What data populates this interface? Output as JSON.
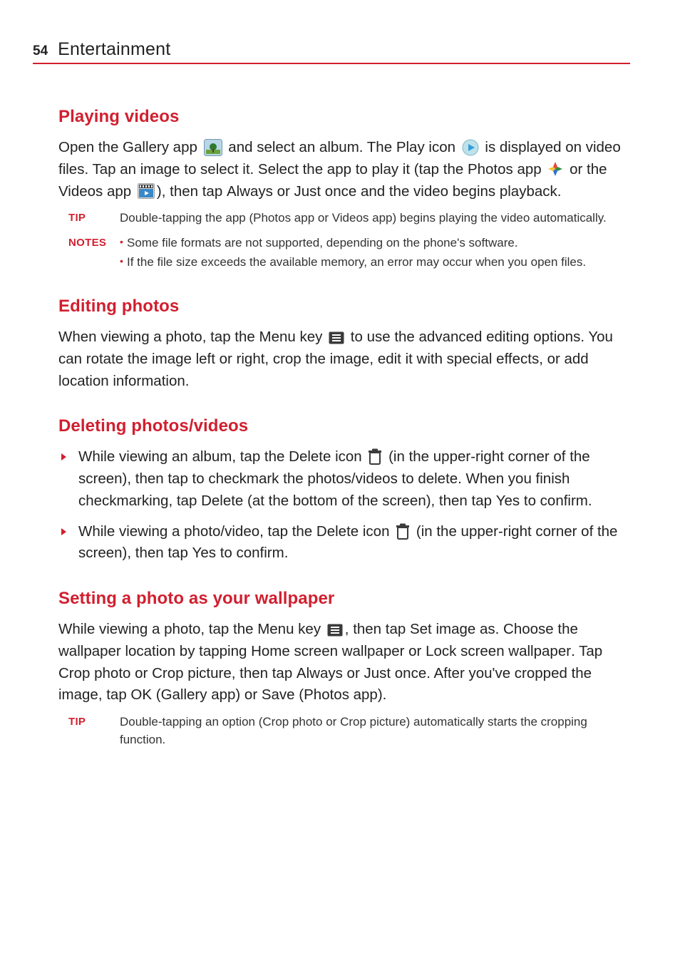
{
  "header": {
    "page_number": "54",
    "title": "Entertainment"
  },
  "sections": {
    "playing_videos": {
      "heading": "Playing videos",
      "p1a": "Open the ",
      "p1b": "Gallery",
      "p1c": " app ",
      "p1d": " and select an album. The ",
      "p1e": "Play",
      "p1f": " icon ",
      "p1g": " is displayed on video files. Tap an image to select it. Select the app to play it (tap the ",
      "p1h": "Photos",
      "p1i": " app ",
      "p1j": " or the ",
      "p1k": "Videos",
      "p1l": " app ",
      "p1m": "), then tap ",
      "p1n": "Always",
      "p1o": " or ",
      "p1p": "Just once",
      "p1q": " and the video begins playback.",
      "tip_label": "TIP",
      "tip1a": "Double-tapping the app (",
      "tip1b": "Photos",
      "tip1c": " app or ",
      "tip1d": "Videos",
      "tip1e": " app) begins playing the video automatically.",
      "notes_label": "NOTES",
      "note1": "Some file formats are not supported, depending on the phone's software.",
      "note2": "If the file size exceeds the available memory, an error may occur when you open files."
    },
    "editing_photos": {
      "heading": "Editing photos",
      "p1a": "When viewing a photo, tap the ",
      "p1b": "Menu key",
      "p1c": " ",
      "p1d": " to use the advanced editing options. You can rotate the image left or right, crop the image, edit it with special effects, or add location information."
    },
    "deleting": {
      "heading": "Deleting photos/videos",
      "li1a": "While viewing an album, tap the ",
      "li1b": "Delete",
      "li1c": " icon ",
      "li1d": " (in the upper-right corner of the screen), then tap to checkmark the photos/videos to delete. When you finish checkmarking, tap ",
      "li1e": "Delete",
      "li1f": " (at the bottom of the screen), then tap ",
      "li1g": "Yes",
      "li1h": " to confirm.",
      "li2a": "While viewing a photo/video, tap the ",
      "li2b": "Delete",
      "li2c": " icon ",
      "li2d": " (in the upper-right corner of the screen), then tap ",
      "li2e": "Yes",
      "li2f": " to confirm."
    },
    "wallpaper": {
      "heading": "Setting a photo as your wallpaper",
      "p1a": "While viewing a photo, tap the ",
      "p1b": "Menu key",
      "p1c": " ",
      "p1d": ", then tap ",
      "p1e": "Set image as",
      "p1f": ". Choose the wallpaper location by tapping ",
      "p1g": "Home screen wallpaper",
      "p1h": " or ",
      "p1i": "Lock screen wallpaper",
      "p1j": ". Tap ",
      "p1k": "Crop photo",
      "p1l": " or ",
      "p1m": "Crop picture",
      "p1n": ", then tap ",
      "p1o": "Always",
      "p1p": " or ",
      "p1q": "Just once",
      "p1r": ". After you've cropped the image, tap ",
      "p1s": "OK",
      "p1t": " (Gallery app) or ",
      "p1u": "Save",
      "p1v": " (Photos app).",
      "tip_label": "TIP",
      "tip1a": "Double-tapping an option (",
      "tip1b": "Crop photo",
      "tip1c": " or ",
      "tip1d": "Crop picture",
      "tip1e": ") automatically starts the cropping function."
    }
  }
}
